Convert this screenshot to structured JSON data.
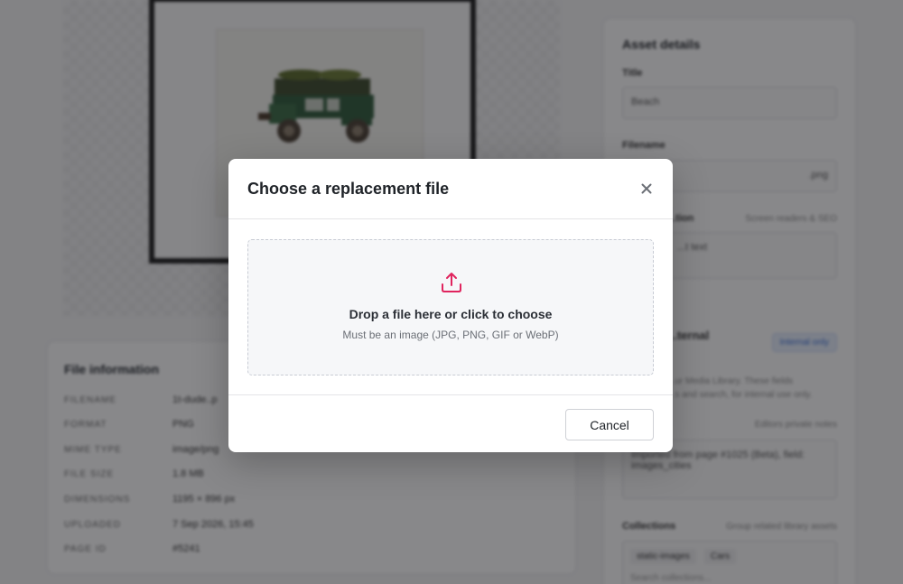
{
  "background": {
    "file_info": {
      "title": "File information",
      "rows": [
        {
          "key": "FILENAME",
          "value": "1t-dude..p"
        },
        {
          "key": "FORMAT",
          "value": "PNG"
        },
        {
          "key": "MIME TYPE",
          "value": "image/png"
        },
        {
          "key": "FILE SIZE",
          "value": "1.8 MB"
        },
        {
          "key": "DIMENSIONS",
          "value": "1195 × 896 px"
        },
        {
          "key": "UPLOADED",
          "value": "7 Sep 2026, 15:45"
        },
        {
          "key": "PAGE ID",
          "value": "#5241"
        }
      ]
    },
    "asset_details": {
      "title": "Asset details",
      "title_label": "Title",
      "title_value": "Beach",
      "filename_label": "Filename",
      "filename_ext": ".png",
      "alt_label": "...tion",
      "alt_hint": "Screen readers & SEO",
      "alt_value": "...t text",
      "internal_heading": "...ternal",
      "internal_badge": "Internal only",
      "internal_desc_1": "...ur Media Library. These fields",
      "internal_desc_2": "...s and search, for internal use only.",
      "notes_hint": "Editors private notes",
      "notes_value": "Imported from page #1025 (Beta), field: images_cities",
      "collections_label": "Collections",
      "collections_hint": "Group related library assets",
      "collections": [
        "static-images",
        "Cars"
      ],
      "collections_placeholder": "Search collections..."
    }
  },
  "modal": {
    "title": "Choose a replacement file",
    "dropzone": {
      "title": "Drop a file here or click to choose",
      "subtitle": "Must be an image (JPG, PNG, GIF or WebP)"
    },
    "cancel_label": "Cancel"
  },
  "colors": {
    "accent": "#e0245e",
    "overlay": "rgba(18,18,22,0.5)"
  },
  "icons": {
    "close": "close-icon",
    "upload": "upload-icon"
  }
}
